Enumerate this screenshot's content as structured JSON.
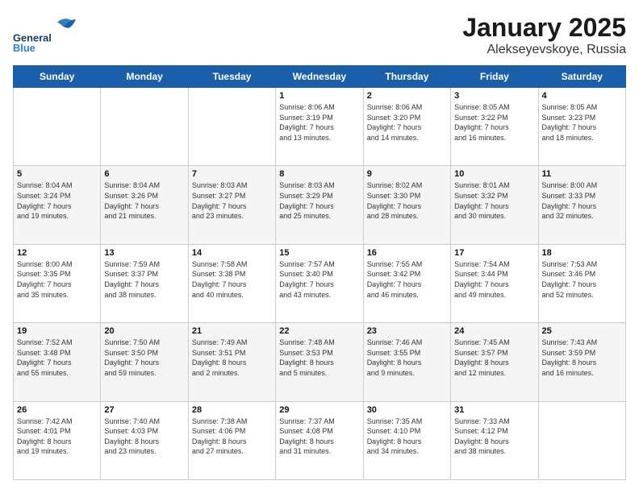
{
  "header": {
    "logo_general": "General",
    "logo_blue": "Blue",
    "title": "January 2025",
    "subtitle": "Alekseyevskoye, Russia"
  },
  "weekdays": [
    "Sunday",
    "Monday",
    "Tuesday",
    "Wednesday",
    "Thursday",
    "Friday",
    "Saturday"
  ],
  "weeks": [
    [
      {
        "day": "",
        "info": ""
      },
      {
        "day": "",
        "info": ""
      },
      {
        "day": "",
        "info": ""
      },
      {
        "day": "1",
        "info": "Sunrise: 8:06 AM\nSunset: 3:19 PM\nDaylight: 7 hours\nand 13 minutes."
      },
      {
        "day": "2",
        "info": "Sunrise: 8:06 AM\nSunset: 3:20 PM\nDaylight: 7 hours\nand 14 minutes."
      },
      {
        "day": "3",
        "info": "Sunrise: 8:05 AM\nSunset: 3:22 PM\nDaylight: 7 hours\nand 16 minutes."
      },
      {
        "day": "4",
        "info": "Sunrise: 8:05 AM\nSunset: 3:23 PM\nDaylight: 7 hours\nand 18 minutes."
      }
    ],
    [
      {
        "day": "5",
        "info": "Sunrise: 8:04 AM\nSunset: 3:24 PM\nDaylight: 7 hours\nand 19 minutes."
      },
      {
        "day": "6",
        "info": "Sunrise: 8:04 AM\nSunset: 3:26 PM\nDaylight: 7 hours\nand 21 minutes."
      },
      {
        "day": "7",
        "info": "Sunrise: 8:03 AM\nSunset: 3:27 PM\nDaylight: 7 hours\nand 23 minutes."
      },
      {
        "day": "8",
        "info": "Sunrise: 8:03 AM\nSunset: 3:29 PM\nDaylight: 7 hours\nand 25 minutes."
      },
      {
        "day": "9",
        "info": "Sunrise: 8:02 AM\nSunset: 3:30 PM\nDaylight: 7 hours\nand 28 minutes."
      },
      {
        "day": "10",
        "info": "Sunrise: 8:01 AM\nSunset: 3:32 PM\nDaylight: 7 hours\nand 30 minutes."
      },
      {
        "day": "11",
        "info": "Sunrise: 8:00 AM\nSunset: 3:33 PM\nDaylight: 7 hours\nand 32 minutes."
      }
    ],
    [
      {
        "day": "12",
        "info": "Sunrise: 8:00 AM\nSunset: 3:35 PM\nDaylight: 7 hours\nand 35 minutes."
      },
      {
        "day": "13",
        "info": "Sunrise: 7:59 AM\nSunset: 3:37 PM\nDaylight: 7 hours\nand 38 minutes."
      },
      {
        "day": "14",
        "info": "Sunrise: 7:58 AM\nSunset: 3:38 PM\nDaylight: 7 hours\nand 40 minutes."
      },
      {
        "day": "15",
        "info": "Sunrise: 7:57 AM\nSunset: 3:40 PM\nDaylight: 7 hours\nand 43 minutes."
      },
      {
        "day": "16",
        "info": "Sunrise: 7:55 AM\nSunset: 3:42 PM\nDaylight: 7 hours\nand 46 minutes."
      },
      {
        "day": "17",
        "info": "Sunrise: 7:54 AM\nSunset: 3:44 PM\nDaylight: 7 hours\nand 49 minutes."
      },
      {
        "day": "18",
        "info": "Sunrise: 7:53 AM\nSunset: 3:46 PM\nDaylight: 7 hours\nand 52 minutes."
      }
    ],
    [
      {
        "day": "19",
        "info": "Sunrise: 7:52 AM\nSunset: 3:48 PM\nDaylight: 7 hours\nand 55 minutes."
      },
      {
        "day": "20",
        "info": "Sunrise: 7:50 AM\nSunset: 3:50 PM\nDaylight: 7 hours\nand 59 minutes."
      },
      {
        "day": "21",
        "info": "Sunrise: 7:49 AM\nSunset: 3:51 PM\nDaylight: 8 hours\nand 2 minutes."
      },
      {
        "day": "22",
        "info": "Sunrise: 7:48 AM\nSunset: 3:53 PM\nDaylight: 8 hours\nand 5 minutes."
      },
      {
        "day": "23",
        "info": "Sunrise: 7:46 AM\nSunset: 3:55 PM\nDaylight: 8 hours\nand 9 minutes."
      },
      {
        "day": "24",
        "info": "Sunrise: 7:45 AM\nSunset: 3:57 PM\nDaylight: 8 hours\nand 12 minutes."
      },
      {
        "day": "25",
        "info": "Sunrise: 7:43 AM\nSunset: 3:59 PM\nDaylight: 8 hours\nand 16 minutes."
      }
    ],
    [
      {
        "day": "26",
        "info": "Sunrise: 7:42 AM\nSunset: 4:01 PM\nDaylight: 8 hours\nand 19 minutes."
      },
      {
        "day": "27",
        "info": "Sunrise: 7:40 AM\nSunset: 4:03 PM\nDaylight: 8 hours\nand 23 minutes."
      },
      {
        "day": "28",
        "info": "Sunrise: 7:38 AM\nSunset: 4:06 PM\nDaylight: 8 hours\nand 27 minutes."
      },
      {
        "day": "29",
        "info": "Sunrise: 7:37 AM\nSunset: 4:08 PM\nDaylight: 8 hours\nand 31 minutes."
      },
      {
        "day": "30",
        "info": "Sunrise: 7:35 AM\nSunset: 4:10 PM\nDaylight: 8 hours\nand 34 minutes."
      },
      {
        "day": "31",
        "info": "Sunrise: 7:33 AM\nSunset: 4:12 PM\nDaylight: 8 hours\nand 38 minutes."
      },
      {
        "day": "",
        "info": ""
      }
    ]
  ]
}
